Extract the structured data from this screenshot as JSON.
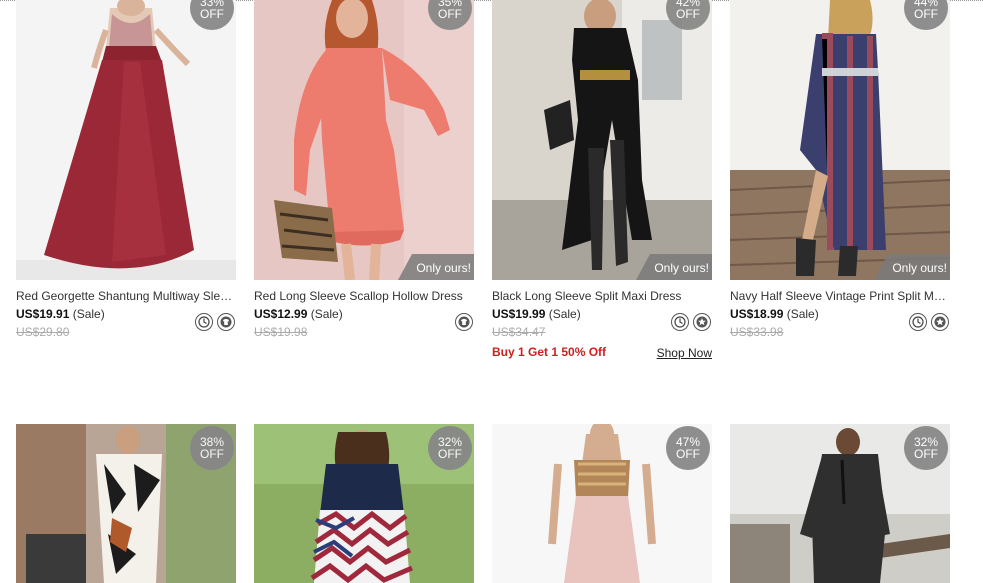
{
  "products": [
    {
      "discount_pct": "33%",
      "discount_label": "OFF",
      "name": "Red Georgette Shantung Multiway Sleeveless Maxi Dress",
      "price": "US$19.91",
      "sale": "(Sale)",
      "old_price": "US$29.80",
      "icons": [
        "clock-icon",
        "shirt-icon"
      ]
    },
    {
      "discount_pct": "35%",
      "discount_label": "OFF",
      "only": "Only ours!",
      "name": "Red Long Sleeve Scallop Hollow Dress",
      "price": "US$12.99",
      "sale": "(Sale)",
      "old_price": "US$19.98",
      "icons": [
        "shirt-icon"
      ]
    },
    {
      "discount_pct": "42%",
      "discount_label": "OFF",
      "only": "Only ours!",
      "name": "Black Long Sleeve Split Maxi Dress",
      "price": "US$19.99",
      "sale": "(Sale)",
      "old_price": "US$34.47",
      "icons": [
        "clock-icon",
        "star-icon"
      ],
      "promo": "Buy 1 Get 1 50% Off",
      "shop_now": "Shop Now"
    },
    {
      "discount_pct": "44%",
      "discount_label": "OFF",
      "only": "Only ours!",
      "name": "Navy Half Sleeve Vintage Print Split Maxi Dress",
      "price": "US$18.99",
      "sale": "(Sale)",
      "old_price": "US$33.98",
      "icons": [
        "clock-icon",
        "star-icon"
      ]
    },
    {
      "discount_pct": "38%",
      "discount_label": "OFF"
    },
    {
      "discount_pct": "32%",
      "discount_label": "OFF"
    },
    {
      "discount_pct": "47%",
      "discount_label": "OFF"
    },
    {
      "discount_pct": "32%",
      "discount_label": "OFF"
    }
  ],
  "colors": {
    "badge": "#878787",
    "promo": "#cc1f1f",
    "old_price": "#aaaaaa"
  }
}
